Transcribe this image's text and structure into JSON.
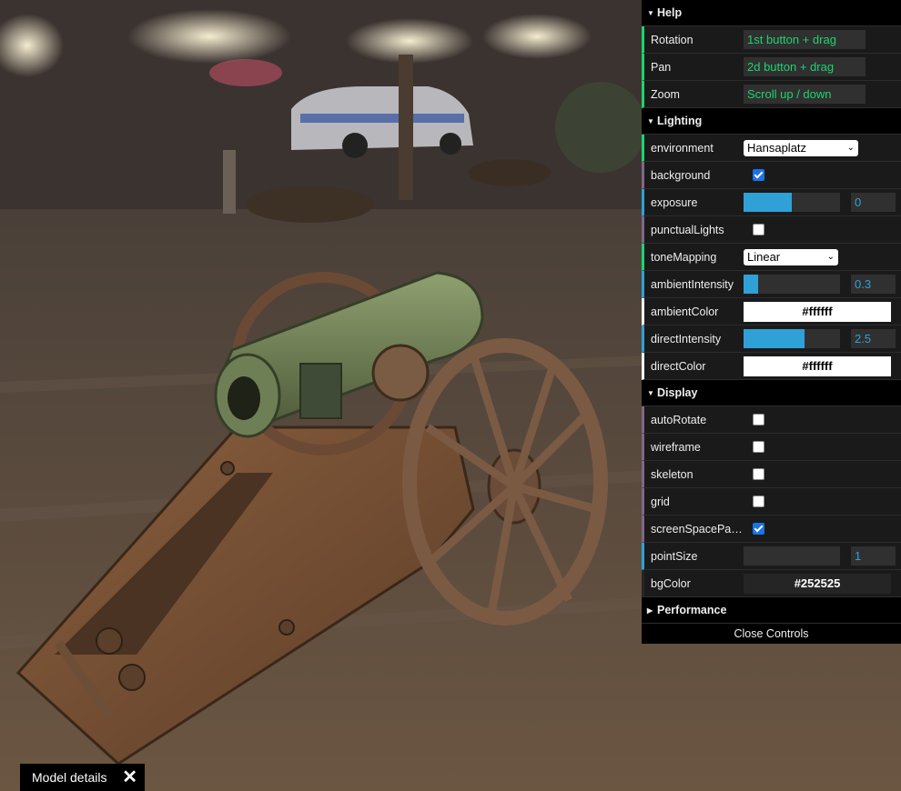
{
  "help": {
    "title": "Help",
    "rows": [
      {
        "label": "Rotation",
        "value": "1st button + drag"
      },
      {
        "label": "Pan",
        "value": "2d button + drag"
      },
      {
        "label": "Zoom",
        "value": "Scroll up / down"
      }
    ]
  },
  "lighting": {
    "title": "Lighting",
    "environment": {
      "label": "environment",
      "value": "Hansaplatz"
    },
    "background": {
      "label": "background",
      "checked": true
    },
    "exposure": {
      "label": "exposure",
      "value": "0",
      "fill": 0.5
    },
    "punctualLights": {
      "label": "punctualLights",
      "checked": false
    },
    "toneMapping": {
      "label": "toneMapping",
      "value": "Linear"
    },
    "ambientIntensity": {
      "label": "ambientIntensity",
      "value": "0.3",
      "fill": 0.15
    },
    "ambientColor": {
      "label": "ambientColor",
      "value": "#ffffff"
    },
    "directIntensity": {
      "label": "directIntensity",
      "value": "2.5",
      "fill": 0.63
    },
    "directColor": {
      "label": "directColor",
      "value": "#ffffff"
    }
  },
  "display": {
    "title": "Display",
    "autoRotate": {
      "label": "autoRotate",
      "checked": false
    },
    "wireframe": {
      "label": "wireframe",
      "checked": false
    },
    "skeleton": {
      "label": "skeleton",
      "checked": false
    },
    "grid": {
      "label": "grid",
      "checked": false
    },
    "screenSpacePanning": {
      "label": "screenSpacePan...",
      "checked": true
    },
    "pointSize": {
      "label": "pointSize",
      "value": "1",
      "fill": 0
    },
    "bgColor": {
      "label": "bgColor",
      "value": "#252525"
    }
  },
  "performance": {
    "title": "Performance"
  },
  "close_label": "Close Controls",
  "model_details": {
    "label": "Model details"
  },
  "colors": {
    "accent_string": "#1ed36f",
    "accent_number": "#2fa1d6",
    "panel_bg": "#1a1a1a"
  }
}
